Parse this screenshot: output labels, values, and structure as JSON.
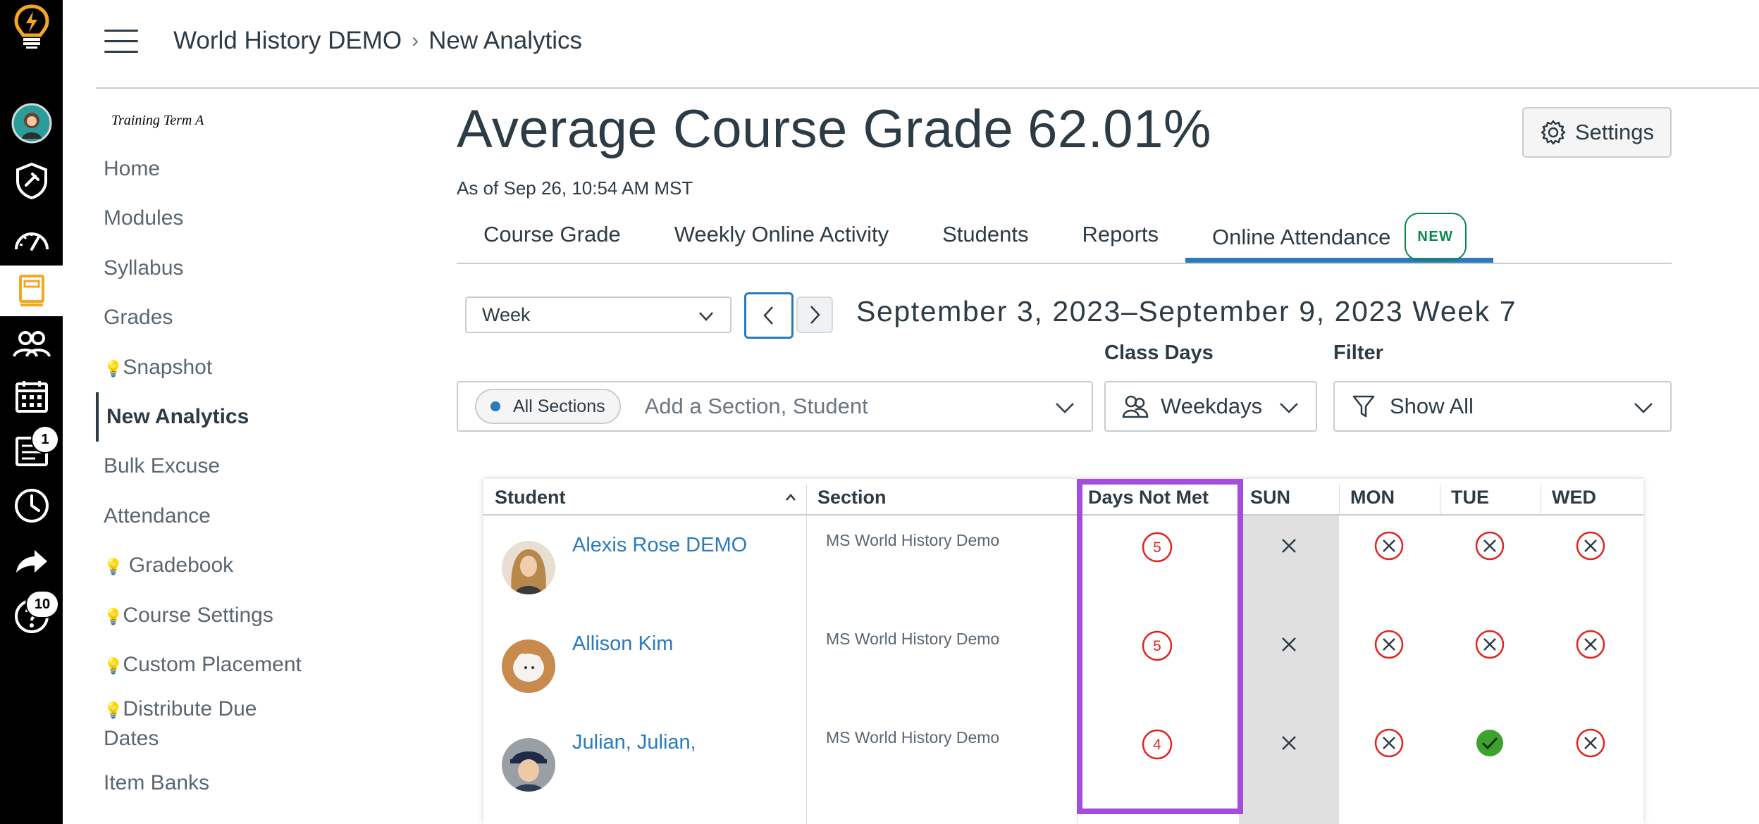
{
  "global_nav": {
    "items": [
      {
        "name": "logo-icon"
      },
      {
        "name": "account-avatar"
      },
      {
        "name": "admin-icon"
      },
      {
        "name": "dashboard-icon"
      },
      {
        "name": "courses-icon"
      },
      {
        "name": "groups-icon"
      },
      {
        "name": "calendar-icon"
      },
      {
        "name": "inbox-icon",
        "badge": "1"
      },
      {
        "name": "history-icon"
      },
      {
        "name": "commons-icon"
      },
      {
        "name": "help-icon",
        "badge": "10"
      }
    ]
  },
  "header": {
    "breadcrumb_course": "World History DEMO",
    "breadcrumb_separator": "›",
    "breadcrumb_current": "New Analytics"
  },
  "course_nav": {
    "term": "Training Term A",
    "items": [
      {
        "label": "Home"
      },
      {
        "label": "Modules"
      },
      {
        "label": "Syllabus"
      },
      {
        "label": "Grades"
      },
      {
        "label": "Snapshot",
        "bulb": true
      },
      {
        "label": "New Analytics",
        "active": true
      },
      {
        "label": "Bulk Excuse"
      },
      {
        "label": "Attendance"
      },
      {
        "label": " Gradebook",
        "bulb": true
      },
      {
        "label": "Course Settings",
        "bulb": true
      },
      {
        "label": "Custom Placement",
        "bulb": true
      },
      {
        "label": "Distribute Due Dates",
        "bulb": true
      },
      {
        "label": "Item Banks"
      }
    ],
    "bulb_glyph": "💡"
  },
  "main": {
    "title": "Average Course Grade",
    "grade": "62.01%",
    "as_of": "As of Sep 26, 10:54 AM MST",
    "settings_label": "Settings",
    "tabs": [
      {
        "label": "Course Grade"
      },
      {
        "label": "Weekly Online Activity"
      },
      {
        "label": "Students"
      },
      {
        "label": "Reports"
      },
      {
        "label": "Online Attendance",
        "badge": "NEW",
        "active": true
      }
    ],
    "period_select": "Week",
    "week_label": "September 3, 2023–September 9, 2023 Week 7",
    "class_days_label": "Class Days",
    "filter_label": "Filter",
    "section_pill": "All Sections",
    "section_placeholder": "Add a Section, Student",
    "class_days_value": "Weekdays",
    "filter_value": "Show All"
  },
  "table": {
    "columns": [
      "Student",
      "Section",
      "Days Not Met",
      "SUN",
      "MON",
      "TUE",
      "WED"
    ],
    "sort_indicator": "^",
    "rows": [
      {
        "student": "Alexis Rose DEMO",
        "section": "MS World History Demo",
        "days_not_met": "5",
        "sun": "off",
        "mon": "not-met",
        "tue": "not-met",
        "wed": "not-met"
      },
      {
        "student": "Allison Kim",
        "section": "MS World History Demo",
        "days_not_met": "5",
        "sun": "off",
        "mon": "not-met",
        "tue": "not-met",
        "wed": "not-met"
      },
      {
        "student": "Julian, Julian,",
        "section": "MS World History Demo",
        "days_not_met": "4",
        "sun": "off",
        "mon": "not-met",
        "tue": "met",
        "wed": "not-met"
      }
    ]
  },
  "colors": {
    "accent_blue": "#2b7abc",
    "not_met_red": "#e0241e",
    "met_green": "#3da12f",
    "highlight_purple": "#a34dde",
    "new_badge_green": "#0b874b"
  }
}
